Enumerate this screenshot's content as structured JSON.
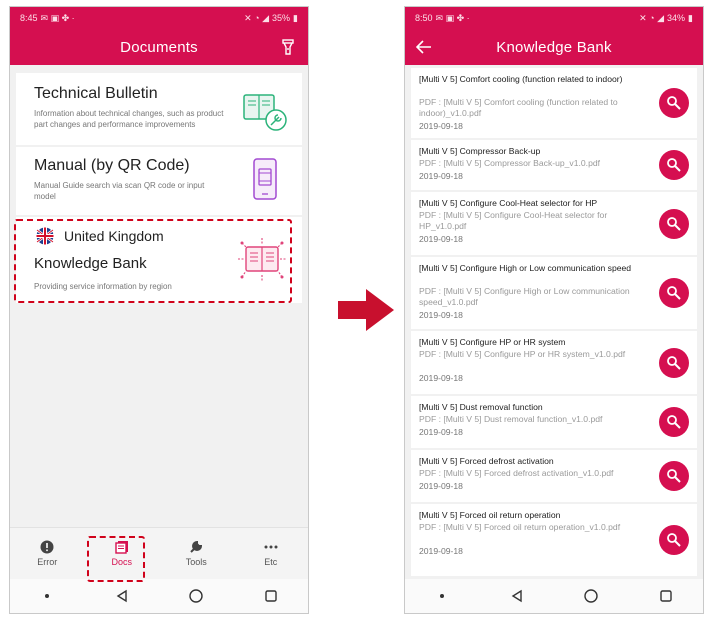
{
  "left": {
    "status_time": "8:45",
    "status_battery": "35%",
    "header_title": "Documents",
    "cards": {
      "technical_bulletin": {
        "title": "Technical Bulletin",
        "desc": "Information about technical changes, such as product part changes and performance improvements"
      },
      "manual": {
        "title": "Manual (by QR Code)",
        "desc": "Manual Guide search via scan QR code or input model"
      },
      "knowledge_bank": {
        "country": "United Kingdom",
        "title": "Knowledge Bank",
        "desc": "Providing service information by region"
      }
    },
    "nav": {
      "error": "Error",
      "docs": "Docs",
      "tools": "Tools",
      "etc": "Etc"
    }
  },
  "right": {
    "status_time": "8:50",
    "status_battery": "34%",
    "header_title": "Knowledge Bank",
    "items": [
      {
        "title": "[Multi V 5] Comfort cooling (function related to indoor)",
        "file": "PDF : [Multi V 5] Comfort cooling (function related to indoor)_v1.0.pdf",
        "date": "2019-09-18"
      },
      {
        "title": "[Multi V 5] Compressor Back-up",
        "file": "PDF : [Multi V 5] Compressor Back-up_v1.0.pdf",
        "date": "2019-09-18"
      },
      {
        "title": "[Multi V 5] Configure Cool-Heat selector for HP",
        "file": "PDF : [Multi V 5] Configure Cool-Heat selector for HP_v1.0.pdf",
        "date": "2019-09-18"
      },
      {
        "title": "[Multi V 5] Configure High or Low communication speed",
        "file": "PDF : [Multi V 5] Configure High or Low communication speed_v1.0.pdf",
        "date": "2019-09-18"
      },
      {
        "title": "[Multi V 5] Configure HP or HR system",
        "file": "PDF : [Multi V 5] Configure HP or HR system_v1.0.pdf",
        "date": "2019-09-18"
      },
      {
        "title": "[Multi V 5] Dust removal function",
        "file": "PDF : [Multi V 5] Dust removal function_v1.0.pdf",
        "date": "2019-09-18"
      },
      {
        "title": "[Multi V 5] Forced defrost activation",
        "file": "PDF : [Multi V 5] Forced defrost activation_v1.0.pdf",
        "date": "2019-09-18"
      },
      {
        "title": "[Multi V 5] Forced oil return operation",
        "file": "PDF : [Multi V 5] Forced oil return operation_v1.0.pdf",
        "date": "2019-09-18"
      }
    ]
  },
  "colors": {
    "brand": "#d50f50",
    "highlight_dash": "#d0021b",
    "arrow": "#c8102e"
  }
}
